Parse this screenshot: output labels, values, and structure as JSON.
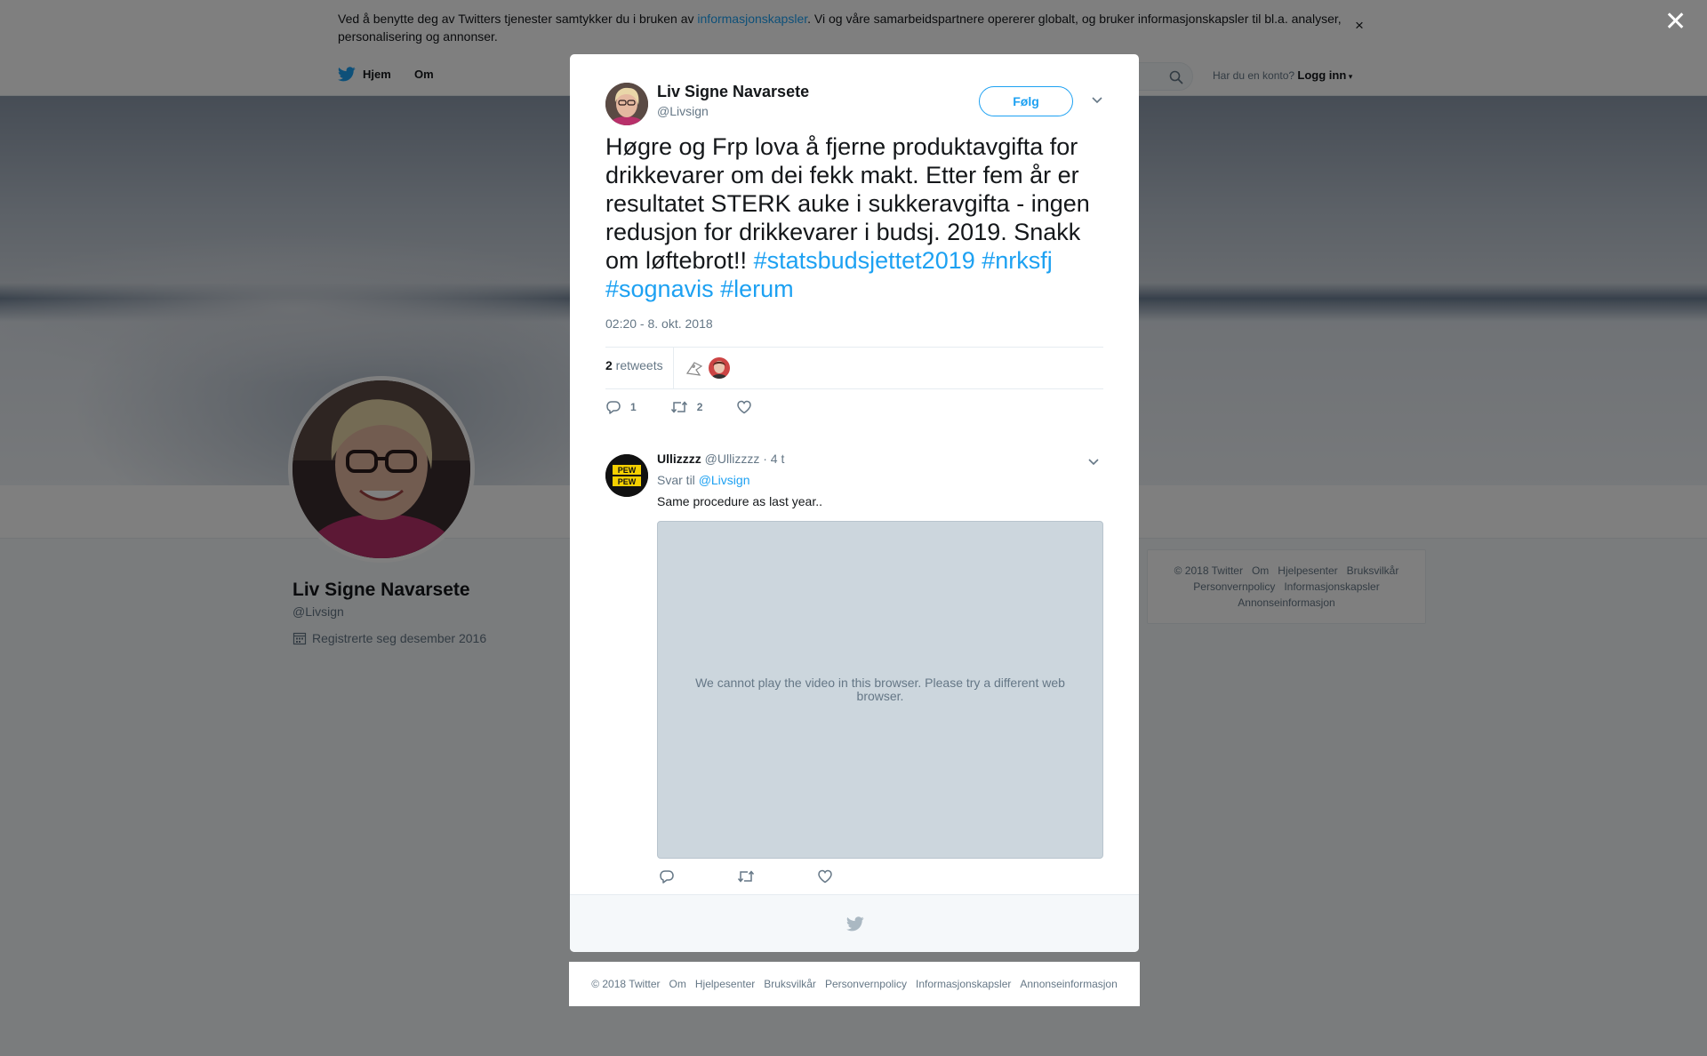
{
  "cookie_banner": {
    "text_before": "Ved å benytte deg av Twitters tjenester samtykker du i bruken av ",
    "link": "informasjonskapsler",
    "text_after": ". Vi og våre samarbeidspartnere opererer globalt, og bruker informasjonskapsler til bl.a. analyser, personalisering og annonser."
  },
  "nav": {
    "home": "Hjem",
    "about": "Om",
    "login_prompt": "Har du en konto?",
    "login": "Logg inn"
  },
  "profile": {
    "name": "Liv Signe Navarsete",
    "handle": "@Livsign",
    "joined": "Registrerte seg desember 2016"
  },
  "side_footer": {
    "links": [
      "© 2018 Twitter",
      "Om",
      "Hjelpesenter",
      "Bruksvilkår",
      "Personvernpolicy",
      "Informasjonskapsler",
      "Annonseinformasjon"
    ]
  },
  "tweet": {
    "name": "Liv Signe Navarsete",
    "handle": "@Livsign",
    "follow": "Følg",
    "text": "Høgre og Frp lova å fjerne produktavgifta for drikkevarer om dei fekk makt. Etter fem år er resultatet STERK auke i sukkeravgifta - ingen redusjon for drikkevarer i budsj. 2019. Snakk om løftebrot!! ",
    "hashtags": [
      "#statsbudsjettet2019",
      "#nrksfj",
      "#sognavis",
      "#lerum"
    ],
    "timestamp": "02:20 - 8. okt. 2018",
    "retweet_count": "2",
    "retweet_label": " retweets",
    "reply_count": "1",
    "rt_count": "2"
  },
  "reply": {
    "name": "Ullizzzz",
    "handle": "@Ullizzzz",
    "time": "· 4 t",
    "reply_to_label": "Svar til ",
    "reply_to_handle": "@Livsign",
    "text": "Same procedure as last year..",
    "video_message": "We cannot play the video in this browser. Please try a different web browser."
  },
  "bottom_footer": {
    "links": [
      "© 2018 Twitter",
      "Om",
      "Hjelpesenter",
      "Bruksvilkår",
      "Personvernpolicy",
      "Informasjonskapsler",
      "Annonseinformasjon"
    ]
  },
  "colors": {
    "accent": "#1da1f2",
    "text": "#14171a",
    "muted": "#657786"
  },
  "icons": [
    "twitter-bird-icon",
    "search-icon",
    "calendar-icon",
    "chevron-down-icon",
    "reply-icon",
    "retweet-icon",
    "like-icon",
    "close-icon"
  ]
}
